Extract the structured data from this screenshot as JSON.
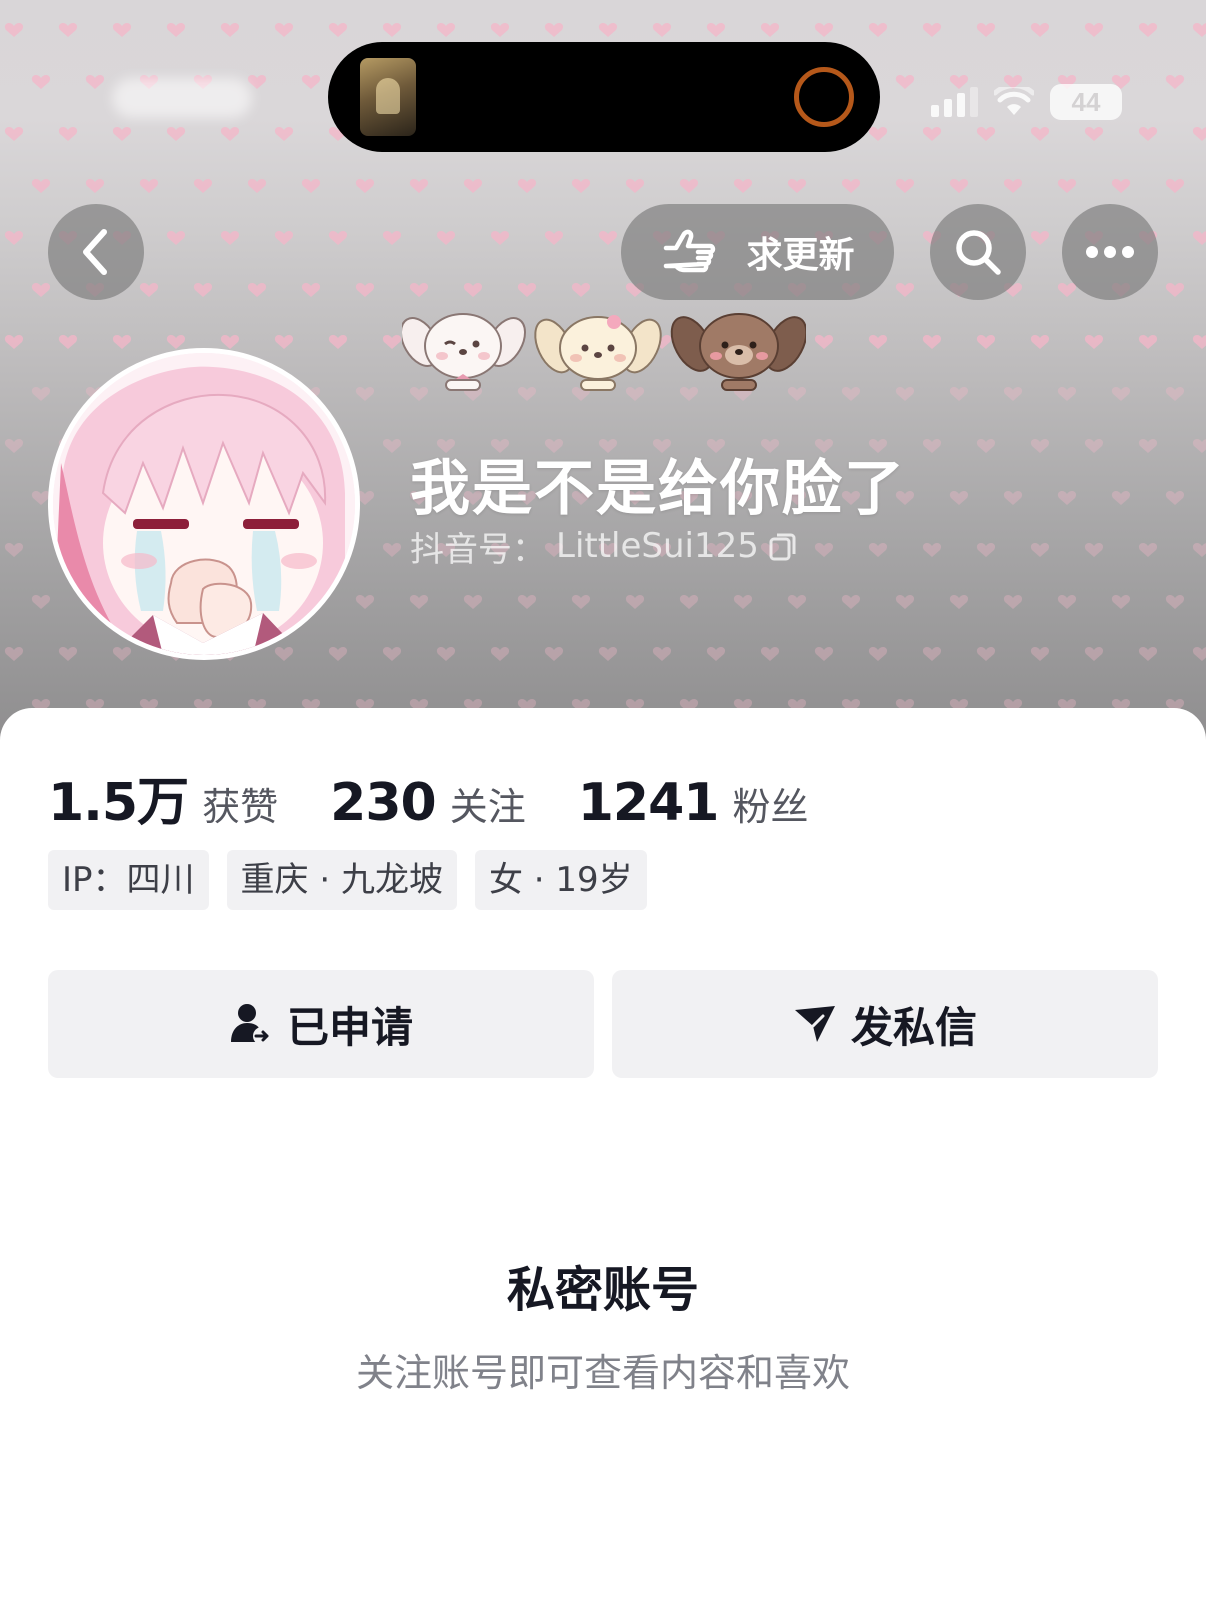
{
  "status_bar": {
    "battery": "44"
  },
  "header": {
    "update_label": "求更新",
    "back_icon": "chevron-left-icon",
    "search_icon": "search-icon",
    "more_icon": "more-dots-icon",
    "update_icon": "pointing-hand-icon"
  },
  "profile": {
    "name": "我是不是给你脸了",
    "douyin_id_label": "抖音号：",
    "douyin_id": "LittleSui125",
    "copy_icon": "copy-icon"
  },
  "stats": [
    {
      "value": "1.5万",
      "label": "获赞"
    },
    {
      "value": "230",
      "label": "关注"
    },
    {
      "value": "1241",
      "label": "粉丝"
    }
  ],
  "tags": [
    "IP：四川",
    "重庆 · 九龙坡",
    "女 · 19岁"
  ],
  "actions": {
    "applied_label": "已申请",
    "message_label": "发私信",
    "applied_icon": "user-request-icon",
    "message_icon": "send-message-icon"
  },
  "private": {
    "title": "私密账号",
    "description": "关注账号即可查看内容和喜欢"
  },
  "colors": {
    "text_primary": "#161823",
    "text_secondary": "#80828a",
    "button_bg": "#f1f1f3",
    "heart": "#f4b6c8",
    "island_ring": "#b5581a"
  }
}
